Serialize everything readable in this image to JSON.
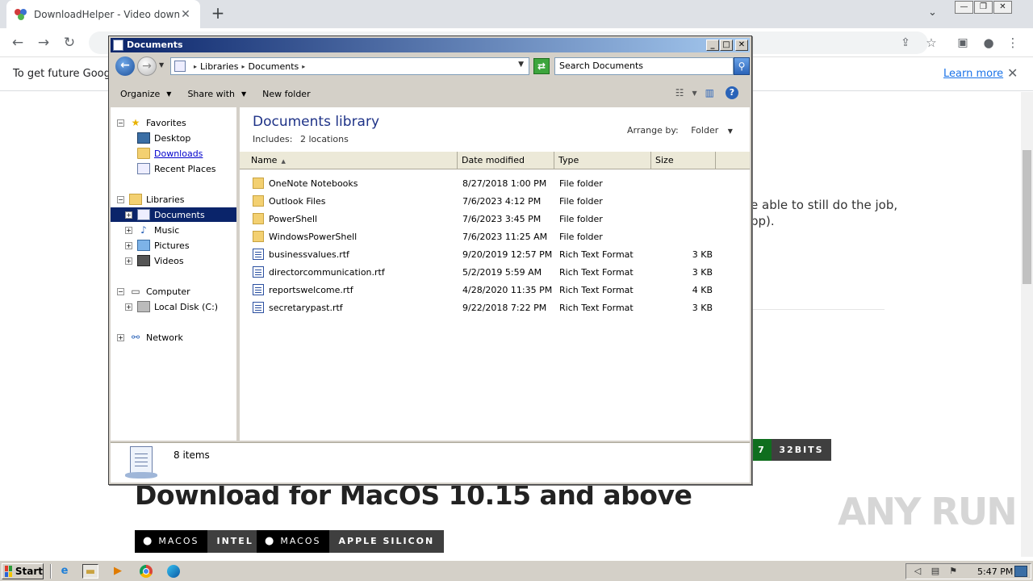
{
  "browser": {
    "tab_title": "DownloadHelper - Video download b",
    "tab_close": "✕",
    "new_tab": "+",
    "tab_dropdown": "⌄",
    "window_controls": [
      "—",
      "❐",
      "✕"
    ],
    "toolbar_icons": [
      "←",
      "→",
      "↻"
    ],
    "infobar_text": "To get future Google",
    "infobar_link": "Learn more",
    "infobar_close": "✕"
  },
  "page": {
    "body_text_line1": "e able to still do the job,",
    "body_text_line2": "pp).",
    "btn_green_label": "7",
    "btn_32bits_label": "32BITS",
    "macos_heading": "Download for MacOS 10.15 and above",
    "mac_buttons": [
      {
        "left": "MACOS",
        "right": "INTEL"
      },
      {
        "left": "MACOS",
        "right": "APPLE SILICON"
      }
    ],
    "watermark": "ANY RUN"
  },
  "explorer": {
    "title": "Documents",
    "title_buttons": [
      "_",
      "□",
      "✕"
    ],
    "breadcrumb": [
      "Libraries",
      "Documents"
    ],
    "search_placeholder": "Search Documents",
    "commands": [
      "Organize",
      "Share with",
      "New folder"
    ],
    "nav_tree": {
      "favorites": {
        "label": "Favorites",
        "items": [
          "Desktop",
          "Downloads",
          "Recent Places"
        ]
      },
      "libraries": {
        "label": "Libraries",
        "items": [
          "Documents",
          "Music",
          "Pictures",
          "Videos"
        ]
      },
      "computer": {
        "label": "Computer",
        "items": [
          "Local Disk (C:)"
        ]
      },
      "network": {
        "label": "Network"
      }
    },
    "library_title": "Documents library",
    "includes_label": "Includes:",
    "includes_value": "2 locations",
    "arrange_label": "Arrange by:",
    "arrange_value": "Folder",
    "columns": [
      "Name",
      "Date modified",
      "Type",
      "Size"
    ],
    "files": [
      {
        "name": "OneNote Notebooks",
        "date": "8/27/2018 1:00 PM",
        "type": "File folder",
        "size": "",
        "kind": "folder"
      },
      {
        "name": "Outlook Files",
        "date": "7/6/2023 4:12 PM",
        "type": "File folder",
        "size": "",
        "kind": "folder"
      },
      {
        "name": "PowerShell",
        "date": "7/6/2023 3:45 PM",
        "type": "File folder",
        "size": "",
        "kind": "folder"
      },
      {
        "name": "WindowsPowerShell",
        "date": "7/6/2023 11:25 AM",
        "type": "File folder",
        "size": "",
        "kind": "folder"
      },
      {
        "name": "businessvalues.rtf",
        "date": "9/20/2019 12:57 PM",
        "type": "Rich Text Format",
        "size": "3 KB",
        "kind": "rtf"
      },
      {
        "name": "directorcommunication.rtf",
        "date": "5/2/2019 5:59 AM",
        "type": "Rich Text Format",
        "size": "3 KB",
        "kind": "rtf"
      },
      {
        "name": "reportswelcome.rtf",
        "date": "4/28/2020 11:35 PM",
        "type": "Rich Text Format",
        "size": "4 KB",
        "kind": "rtf"
      },
      {
        "name": "secretarypast.rtf",
        "date": "9/22/2018 7:22 PM",
        "type": "Rich Text Format",
        "size": "3 KB",
        "kind": "rtf"
      }
    ],
    "status_count": "8 items"
  },
  "taskbar": {
    "start_label": "Start",
    "clock": "5:47 PM"
  }
}
